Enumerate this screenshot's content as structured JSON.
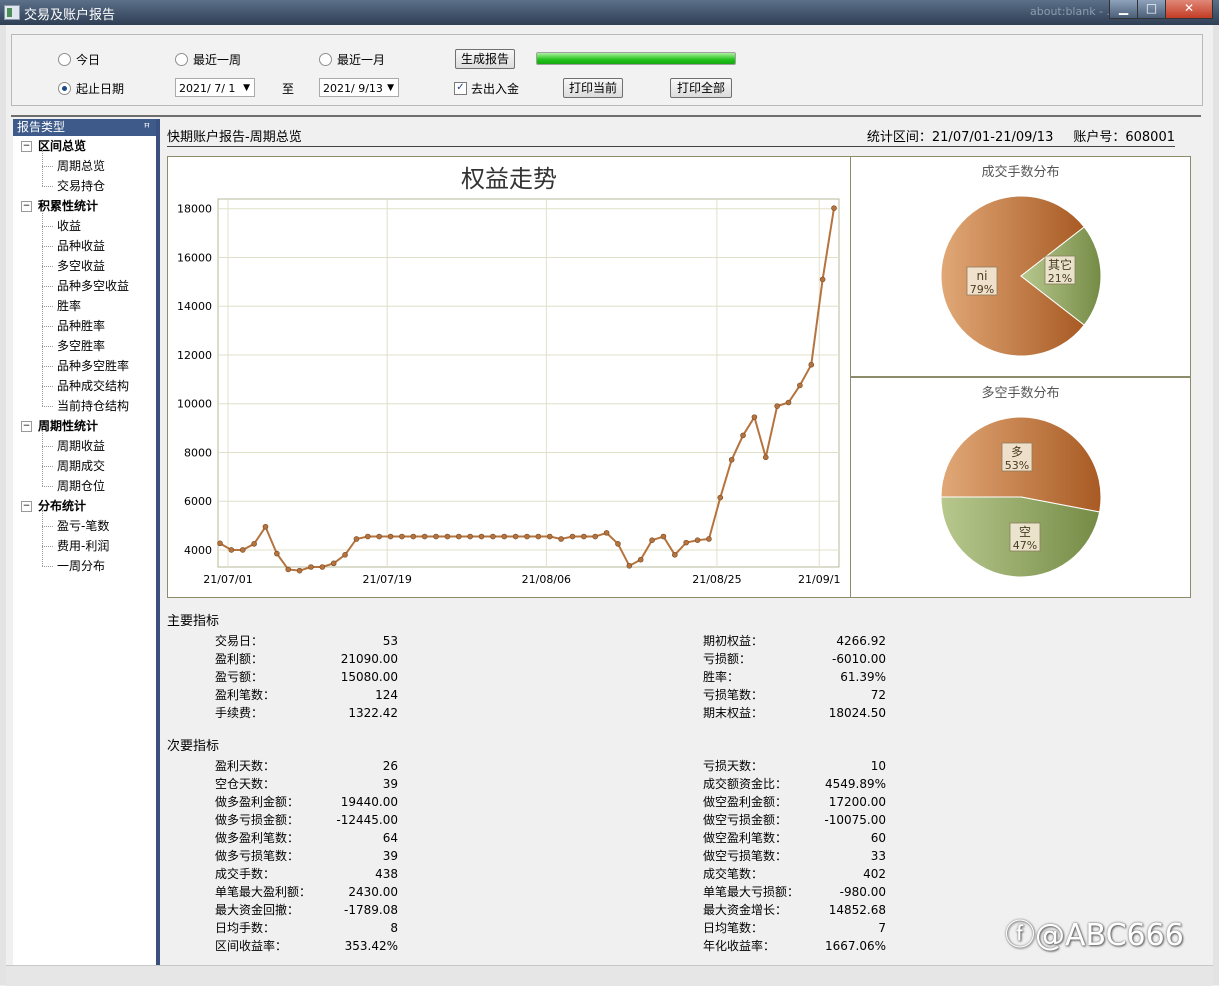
{
  "window": {
    "title": "交易及账户报告",
    "ghost_text": "about:blank - ..."
  },
  "toolbar": {
    "radios": [
      {
        "label": "今日",
        "checked": false
      },
      {
        "label": "最近一周",
        "checked": false
      },
      {
        "label": "最近一月",
        "checked": false
      },
      {
        "label": "起止日期",
        "checked": true
      }
    ],
    "date_from": "2021/ 7/ 1",
    "to_label": "至",
    "date_to": "2021/ 9/13",
    "generate_label": "生成报告",
    "progress": 1.0,
    "exclude_deposit_label": "去出入金",
    "exclude_deposit_checked": true,
    "print_current_label": "打印当前",
    "print_all_label": "打印全部"
  },
  "sidebar": {
    "header": "报告类型",
    "pin_icon": "pin-icon",
    "groups": [
      {
        "label": "区间总览",
        "items": [
          "周期总览",
          "交易持仓"
        ]
      },
      {
        "label": "积累性统计",
        "items": [
          "收益",
          "品种收益",
          "多空收益",
          "品种多空收益",
          "胜率",
          "品种胜率",
          "多空胜率",
          "品种多空胜率",
          "品种成交结构",
          "当前持仓结构"
        ]
      },
      {
        "label": "周期性统计",
        "items": [
          "周期收益",
          "周期成交",
          "周期仓位"
        ]
      },
      {
        "label": "分布统计",
        "items": [
          "盈亏-笔数",
          "费用-利润",
          "一周分布"
        ]
      }
    ]
  },
  "report": {
    "title": "快期账户报告-周期总览",
    "period": "统计区间：21/07/01-21/09/13",
    "account": "账户号：608001"
  },
  "chart_data": [
    {
      "type": "line",
      "title": "权益走势",
      "x_ticks": [
        "21/07/01",
        "21/07/19",
        "21/08/06",
        "21/08/25",
        "21/09/1"
      ],
      "y_ticks": [
        4000,
        6000,
        8000,
        10000,
        12000,
        14000,
        16000,
        18000
      ],
      "ylim": [
        3300,
        18400
      ],
      "x_count": 53,
      "values": [
        4270,
        4000,
        4000,
        4250,
        4950,
        3850,
        3200,
        3150,
        3300,
        3300,
        3450,
        3800,
        4450,
        4550,
        4550,
        4550,
        4550,
        4550,
        4550,
        4550,
        4550,
        4550,
        4550,
        4550,
        4550,
        4550,
        4550,
        4550,
        4550,
        4550,
        4450,
        4550,
        4550,
        4550,
        4700,
        4250,
        3350,
        3600,
        4400,
        4550,
        3800,
        4300,
        4400,
        4450,
        6150,
        7700,
        8700,
        9450,
        7800,
        9900,
        10050,
        10750,
        11600,
        15100,
        18024.5
      ],
      "line_color": "#b5743f",
      "grid": true
    },
    {
      "type": "pie",
      "title": "成交手数分布",
      "slices": [
        {
          "label": "ni",
          "value": 79,
          "percent": "79%",
          "color": "#c97b45"
        },
        {
          "label": "其它",
          "value": 21,
          "percent": "21%",
          "color": "#93a96a"
        }
      ]
    },
    {
      "type": "pie",
      "title": "多空手数分布",
      "slices": [
        {
          "label": "多",
          "value": 53,
          "percent": "53%",
          "color": "#c97b45"
        },
        {
          "label": "空",
          "value": 47,
          "percent": "47%",
          "color": "#93a96a"
        }
      ]
    }
  ],
  "main_metrics": {
    "title": "主要指标",
    "left": [
      {
        "label": "交易日：",
        "value": "53"
      },
      {
        "label": "盈利额：",
        "value": "21090.00"
      },
      {
        "label": "盈亏额：",
        "value": "15080.00"
      },
      {
        "label": "盈利笔数：",
        "value": "124"
      },
      {
        "label": "手续费：",
        "value": "1322.42"
      }
    ],
    "right": [
      {
        "label": "期初权益：",
        "value": "4266.92"
      },
      {
        "label": "亏损额：",
        "value": "-6010.00"
      },
      {
        "label": "胜率：",
        "value": "61.39%"
      },
      {
        "label": "亏损笔数：",
        "value": "72"
      },
      {
        "label": "期末权益：",
        "value": "18024.50"
      }
    ]
  },
  "secondary_metrics": {
    "title": "次要指标",
    "left": [
      {
        "label": "盈利天数：",
        "value": "26"
      },
      {
        "label": "空仓天数：",
        "value": "39"
      },
      {
        "label": "做多盈利金额：",
        "value": "19440.00"
      },
      {
        "label": "做多亏损金额：",
        "value": "-12445.00"
      },
      {
        "label": "做多盈利笔数：",
        "value": "64"
      },
      {
        "label": "做多亏损笔数：",
        "value": "39"
      },
      {
        "label": "成交手数：",
        "value": "438"
      },
      {
        "label": "单笔最大盈利额：",
        "value": "2430.00"
      },
      {
        "label": "最大资金回撤：",
        "value": "-1789.08"
      },
      {
        "label": "日均手数：",
        "value": "8"
      },
      {
        "label": "区间收益率：",
        "value": "353.42%"
      }
    ],
    "right": [
      {
        "label": "亏损天数：",
        "value": "10"
      },
      {
        "label": "成交额资金比：",
        "value": "4549.89%"
      },
      {
        "label": "做空盈利金额：",
        "value": "17200.00"
      },
      {
        "label": "做空亏损金额：",
        "value": "-10075.00"
      },
      {
        "label": "做空盈利笔数：",
        "value": "60"
      },
      {
        "label": "做空亏损笔数：",
        "value": "33"
      },
      {
        "label": "成交笔数：",
        "value": "402"
      },
      {
        "label": "单笔最大亏损额：",
        "value": "-980.00"
      },
      {
        "label": "最大资金增长：",
        "value": "14852.68"
      },
      {
        "label": "日均笔数：",
        "value": "7"
      },
      {
        "label": "年化收益率：",
        "value": "1667.06%"
      }
    ]
  },
  "watermark": "@ABC666"
}
